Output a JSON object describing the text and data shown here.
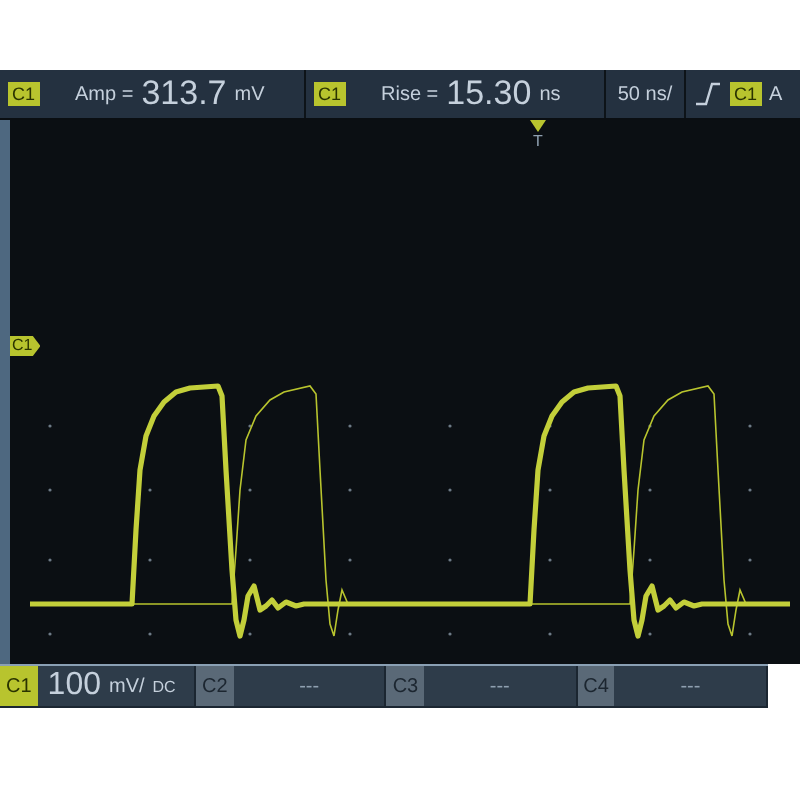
{
  "top_bar": {
    "measurements": [
      {
        "channel": "C1",
        "name": "Amp =",
        "value": "313.7",
        "unit": "mV"
      },
      {
        "channel": "C1",
        "name": "Rise =",
        "value": "15.30",
        "unit": "ns"
      }
    ],
    "timebase": "50 ns/",
    "trigger": {
      "channel": "C1",
      "text": "A"
    }
  },
  "screen": {
    "trigger_marker": "T",
    "channel_marker": "C1"
  },
  "bottom_bar": {
    "channels": [
      {
        "label": "C1",
        "active": true,
        "scale": "100",
        "unit": "mV/",
        "coupling": "DC"
      },
      {
        "label": "C2",
        "active": false,
        "value": "---"
      },
      {
        "label": "C3",
        "active": false,
        "value": "---"
      },
      {
        "label": "C4",
        "active": false,
        "value": "---"
      }
    ]
  }
}
